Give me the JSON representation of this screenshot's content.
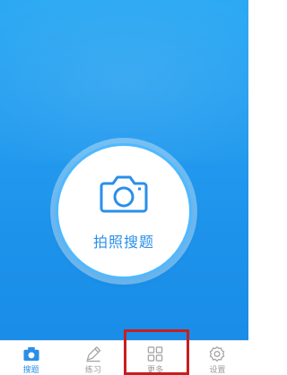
{
  "main": {
    "capture_label": "拍照搜题"
  },
  "tabs": [
    {
      "label": "搜题",
      "icon": "camera-icon",
      "active": true
    },
    {
      "label": "练习",
      "icon": "pen-icon",
      "active": false
    },
    {
      "label": "更多",
      "icon": "grid-icon",
      "active": false
    },
    {
      "label": "设置",
      "icon": "gear-icon",
      "active": false
    }
  ],
  "colors": {
    "accent": "#2a8fe9",
    "background": "#1e93eb",
    "annotation": "#c81e1e"
  }
}
